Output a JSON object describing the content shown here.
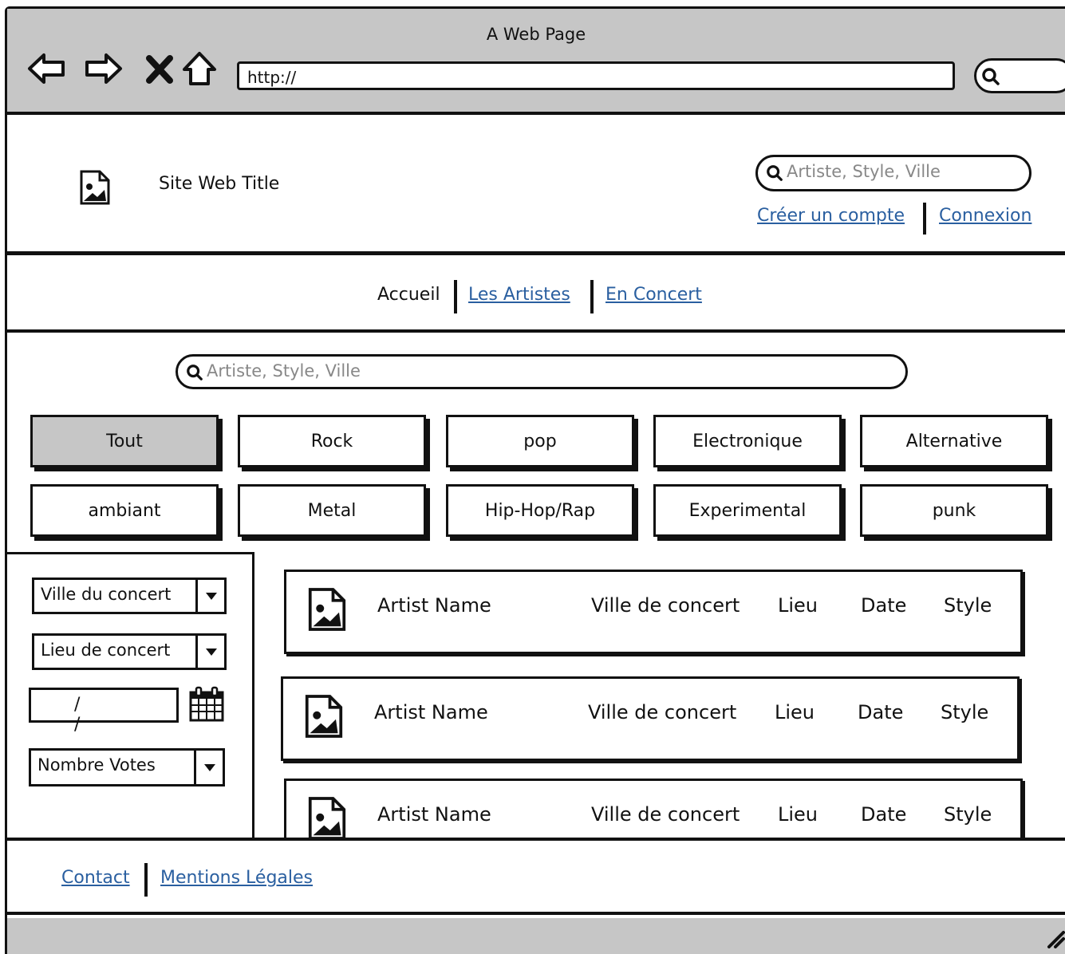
{
  "browser": {
    "window_title": "A Web Page",
    "url": "http://"
  },
  "header": {
    "site_title": "Site Web Title",
    "search_placeholder": "Artiste, Style, Ville",
    "create_account": "Créer un compte",
    "login": "Connexion"
  },
  "nav": {
    "home": "Accueil",
    "artists": "Les Artistes",
    "concert": "En Concert"
  },
  "main_search": {
    "placeholder": "Artiste, Style, Ville"
  },
  "genres": [
    "Tout",
    "Rock",
    "pop",
    "Electronique",
    "Alternative",
    "ambiant",
    "Metal",
    "Hip-Hop/Rap",
    "Experimental",
    "punk"
  ],
  "filters": {
    "city": "Ville du concert",
    "venue": "Lieu de concert",
    "date": "/ /",
    "votes": "Nombre Votes"
  },
  "concerts": [
    {
      "artist": "Artist Name",
      "city": "Ville de concert",
      "venue": "Lieu",
      "date": "Date",
      "style": "Style"
    },
    {
      "artist": "Artist Name",
      "city": "Ville de concert",
      "venue": "Lieu",
      "date": "Date",
      "style": "Style"
    },
    {
      "artist": "Artist Name",
      "city": "Ville de concert",
      "venue": "Lieu",
      "date": "Date",
      "style": "Style"
    }
  ],
  "footer": {
    "contact": "Contact",
    "legal": "Mentions Légales"
  },
  "icons": {
    "back": "back-arrow-icon",
    "forward": "forward-arrow-icon",
    "stop": "close-icon",
    "home": "home-icon",
    "search": "search-icon",
    "image": "image-icon",
    "calendar": "calendar-icon",
    "dropdown": "chevron-down-icon",
    "resize": "resize-grip-icon"
  },
  "colors": {
    "chrome": "#c6c6c6",
    "link": "#2a5fa0",
    "ink": "#111111"
  }
}
